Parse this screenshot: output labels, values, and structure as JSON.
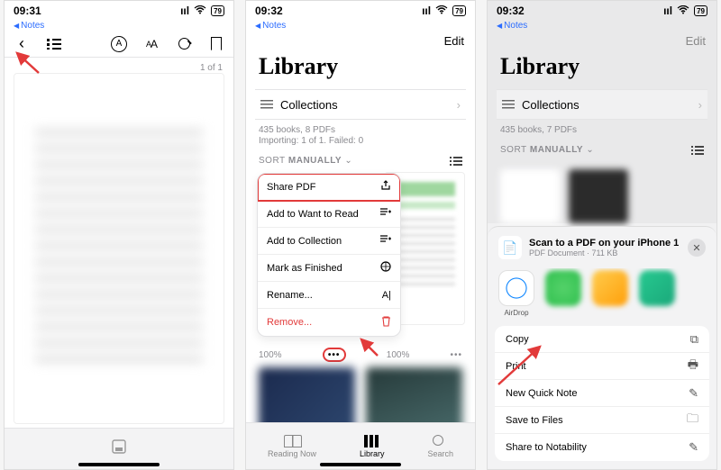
{
  "phone1": {
    "time": "09:31",
    "battery": "79",
    "back_app": "Notes",
    "page_counter": "1 of 1"
  },
  "phone2": {
    "time": "09:32",
    "battery": "79",
    "back_app": "Notes",
    "edit": "Edit",
    "title": "Library",
    "collections": "Collections",
    "meta_line1": "435 books, 8 PDFs",
    "meta_line2": "Importing: 1 of 1. Failed: 0",
    "sort_prefix": "SORT",
    "sort_value": "MANUALLY",
    "menu": {
      "share": "Share PDF",
      "want": "Add to Want to Read",
      "coll": "Add to Collection",
      "finished": "Mark as Finished",
      "rename": "Rename...",
      "remove": "Remove..."
    },
    "pct_left": "100%",
    "pct_right": "100%",
    "tabs": {
      "reading": "Reading Now",
      "library": "Library",
      "search": "Search"
    }
  },
  "phone3": {
    "time": "09:32",
    "battery": "79",
    "back_app": "Notes",
    "edit": "Edit",
    "title": "Library",
    "collections": "Collections",
    "meta_line1": "435 books, 7 PDFs",
    "sort_prefix": "SORT",
    "sort_value": "MANUALLY",
    "sheet": {
      "doc_title": "Scan to a PDF on your iPhone 1",
      "doc_sub": "PDF Document · 711 KB",
      "airdrop": "AirDrop",
      "actions": {
        "copy": "Copy",
        "print": "Print",
        "note": "New Quick Note",
        "save": "Save to Files",
        "notability": "Share to Notability"
      }
    }
  }
}
